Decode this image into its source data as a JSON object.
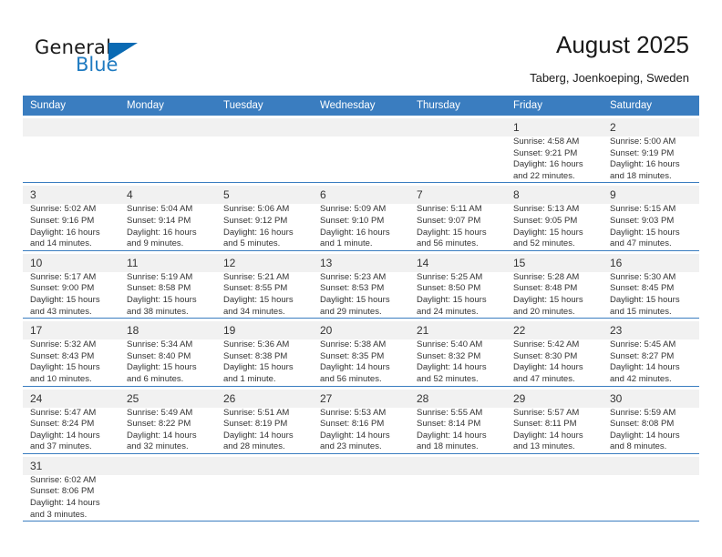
{
  "brand": {
    "name_top": "General",
    "name_bottom": "Blue",
    "accent_color": "#0a6ab3",
    "text_color": "#1f7bc1"
  },
  "header": {
    "title": "August 2025",
    "subtitle": "Taberg, Joenkoeping, Sweden"
  },
  "calendar": {
    "header_bg": "#3a7dc0",
    "weekdays": [
      "Sunday",
      "Monday",
      "Tuesday",
      "Wednesday",
      "Thursday",
      "Friday",
      "Saturday"
    ],
    "weeks": [
      [
        {
          "day": "",
          "empty": true
        },
        {
          "day": "",
          "empty": true
        },
        {
          "day": "",
          "empty": true
        },
        {
          "day": "",
          "empty": true
        },
        {
          "day": "",
          "empty": true
        },
        {
          "day": "1",
          "sunrise": "Sunrise: 4:58 AM",
          "sunset": "Sunset: 9:21 PM",
          "daylight1": "Daylight: 16 hours",
          "daylight2": "and 22 minutes."
        },
        {
          "day": "2",
          "sunrise": "Sunrise: 5:00 AM",
          "sunset": "Sunset: 9:19 PM",
          "daylight1": "Daylight: 16 hours",
          "daylight2": "and 18 minutes."
        }
      ],
      [
        {
          "day": "3",
          "sunrise": "Sunrise: 5:02 AM",
          "sunset": "Sunset: 9:16 PM",
          "daylight1": "Daylight: 16 hours",
          "daylight2": "and 14 minutes."
        },
        {
          "day": "4",
          "sunrise": "Sunrise: 5:04 AM",
          "sunset": "Sunset: 9:14 PM",
          "daylight1": "Daylight: 16 hours",
          "daylight2": "and 9 minutes."
        },
        {
          "day": "5",
          "sunrise": "Sunrise: 5:06 AM",
          "sunset": "Sunset: 9:12 PM",
          "daylight1": "Daylight: 16 hours",
          "daylight2": "and 5 minutes."
        },
        {
          "day": "6",
          "sunrise": "Sunrise: 5:09 AM",
          "sunset": "Sunset: 9:10 PM",
          "daylight1": "Daylight: 16 hours",
          "daylight2": "and 1 minute."
        },
        {
          "day": "7",
          "sunrise": "Sunrise: 5:11 AM",
          "sunset": "Sunset: 9:07 PM",
          "daylight1": "Daylight: 15 hours",
          "daylight2": "and 56 minutes."
        },
        {
          "day": "8",
          "sunrise": "Sunrise: 5:13 AM",
          "sunset": "Sunset: 9:05 PM",
          "daylight1": "Daylight: 15 hours",
          "daylight2": "and 52 minutes."
        },
        {
          "day": "9",
          "sunrise": "Sunrise: 5:15 AM",
          "sunset": "Sunset: 9:03 PM",
          "daylight1": "Daylight: 15 hours",
          "daylight2": "and 47 minutes."
        }
      ],
      [
        {
          "day": "10",
          "sunrise": "Sunrise: 5:17 AM",
          "sunset": "Sunset: 9:00 PM",
          "daylight1": "Daylight: 15 hours",
          "daylight2": "and 43 minutes."
        },
        {
          "day": "11",
          "sunrise": "Sunrise: 5:19 AM",
          "sunset": "Sunset: 8:58 PM",
          "daylight1": "Daylight: 15 hours",
          "daylight2": "and 38 minutes."
        },
        {
          "day": "12",
          "sunrise": "Sunrise: 5:21 AM",
          "sunset": "Sunset: 8:55 PM",
          "daylight1": "Daylight: 15 hours",
          "daylight2": "and 34 minutes."
        },
        {
          "day": "13",
          "sunrise": "Sunrise: 5:23 AM",
          "sunset": "Sunset: 8:53 PM",
          "daylight1": "Daylight: 15 hours",
          "daylight2": "and 29 minutes."
        },
        {
          "day": "14",
          "sunrise": "Sunrise: 5:25 AM",
          "sunset": "Sunset: 8:50 PM",
          "daylight1": "Daylight: 15 hours",
          "daylight2": "and 24 minutes."
        },
        {
          "day": "15",
          "sunrise": "Sunrise: 5:28 AM",
          "sunset": "Sunset: 8:48 PM",
          "daylight1": "Daylight: 15 hours",
          "daylight2": "and 20 minutes."
        },
        {
          "day": "16",
          "sunrise": "Sunrise: 5:30 AM",
          "sunset": "Sunset: 8:45 PM",
          "daylight1": "Daylight: 15 hours",
          "daylight2": "and 15 minutes."
        }
      ],
      [
        {
          "day": "17",
          "sunrise": "Sunrise: 5:32 AM",
          "sunset": "Sunset: 8:43 PM",
          "daylight1": "Daylight: 15 hours",
          "daylight2": "and 10 minutes."
        },
        {
          "day": "18",
          "sunrise": "Sunrise: 5:34 AM",
          "sunset": "Sunset: 8:40 PM",
          "daylight1": "Daylight: 15 hours",
          "daylight2": "and 6 minutes."
        },
        {
          "day": "19",
          "sunrise": "Sunrise: 5:36 AM",
          "sunset": "Sunset: 8:38 PM",
          "daylight1": "Daylight: 15 hours",
          "daylight2": "and 1 minute."
        },
        {
          "day": "20",
          "sunrise": "Sunrise: 5:38 AM",
          "sunset": "Sunset: 8:35 PM",
          "daylight1": "Daylight: 14 hours",
          "daylight2": "and 56 minutes."
        },
        {
          "day": "21",
          "sunrise": "Sunrise: 5:40 AM",
          "sunset": "Sunset: 8:32 PM",
          "daylight1": "Daylight: 14 hours",
          "daylight2": "and 52 minutes."
        },
        {
          "day": "22",
          "sunrise": "Sunrise: 5:42 AM",
          "sunset": "Sunset: 8:30 PM",
          "daylight1": "Daylight: 14 hours",
          "daylight2": "and 47 minutes."
        },
        {
          "day": "23",
          "sunrise": "Sunrise: 5:45 AM",
          "sunset": "Sunset: 8:27 PM",
          "daylight1": "Daylight: 14 hours",
          "daylight2": "and 42 minutes."
        }
      ],
      [
        {
          "day": "24",
          "sunrise": "Sunrise: 5:47 AM",
          "sunset": "Sunset: 8:24 PM",
          "daylight1": "Daylight: 14 hours",
          "daylight2": "and 37 minutes."
        },
        {
          "day": "25",
          "sunrise": "Sunrise: 5:49 AM",
          "sunset": "Sunset: 8:22 PM",
          "daylight1": "Daylight: 14 hours",
          "daylight2": "and 32 minutes."
        },
        {
          "day": "26",
          "sunrise": "Sunrise: 5:51 AM",
          "sunset": "Sunset: 8:19 PM",
          "daylight1": "Daylight: 14 hours",
          "daylight2": "and 28 minutes."
        },
        {
          "day": "27",
          "sunrise": "Sunrise: 5:53 AM",
          "sunset": "Sunset: 8:16 PM",
          "daylight1": "Daylight: 14 hours",
          "daylight2": "and 23 minutes."
        },
        {
          "day": "28",
          "sunrise": "Sunrise: 5:55 AM",
          "sunset": "Sunset: 8:14 PM",
          "daylight1": "Daylight: 14 hours",
          "daylight2": "and 18 minutes."
        },
        {
          "day": "29",
          "sunrise": "Sunrise: 5:57 AM",
          "sunset": "Sunset: 8:11 PM",
          "daylight1": "Daylight: 14 hours",
          "daylight2": "and 13 minutes."
        },
        {
          "day": "30",
          "sunrise": "Sunrise: 5:59 AM",
          "sunset": "Sunset: 8:08 PM",
          "daylight1": "Daylight: 14 hours",
          "daylight2": "and 8 minutes."
        }
      ],
      [
        {
          "day": "31",
          "sunrise": "Sunrise: 6:02 AM",
          "sunset": "Sunset: 8:06 PM",
          "daylight1": "Daylight: 14 hours",
          "daylight2": "and 3 minutes."
        },
        {
          "day": "",
          "empty": true
        },
        {
          "day": "",
          "empty": true
        },
        {
          "day": "",
          "empty": true
        },
        {
          "day": "",
          "empty": true
        },
        {
          "day": "",
          "empty": true
        },
        {
          "day": "",
          "empty": true
        }
      ]
    ]
  }
}
